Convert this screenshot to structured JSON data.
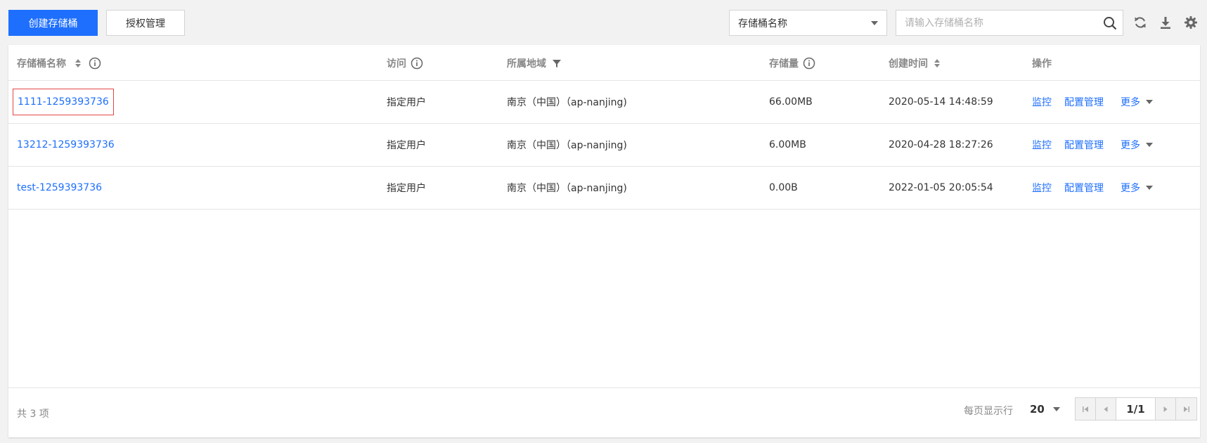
{
  "toolbar": {
    "create_label": "创建存储桶",
    "auth_label": "授权管理",
    "filter_selected": "存储桶名称",
    "search_placeholder": "请输入存储桶名称"
  },
  "table": {
    "columns": {
      "name": "存储桶名称",
      "access": "访问",
      "region": "所属地域",
      "storage": "存储量",
      "created": "创建时间",
      "ops": "操作"
    },
    "rows": [
      {
        "name": "1111-1259393736",
        "access": "指定用户",
        "region": "南京（中国）（ap-nanjing)",
        "storage": "66.00MB",
        "created": "2020-05-14 14:48:59"
      },
      {
        "name": "13212-1259393736",
        "access": "指定用户",
        "region": "南京（中国）（ap-nanjing)",
        "storage": "6.00MB",
        "created": "2020-04-28 18:27:26"
      },
      {
        "name": "test-1259393736",
        "access": "指定用户",
        "region": "南京（中国）（ap-nanjing)",
        "storage": "0.00B",
        "created": "2022-01-05 20:05:54"
      }
    ],
    "op_monitor": "监控",
    "op_config": "配置管理",
    "op_more": "更多"
  },
  "footer": {
    "total": "共 3 项",
    "page_size_label": "每页显示行",
    "page_size": "20",
    "page_indicator": "1/1"
  },
  "colors": {
    "primary": "#1e6ffe",
    "highlight_border": "#e54545"
  }
}
